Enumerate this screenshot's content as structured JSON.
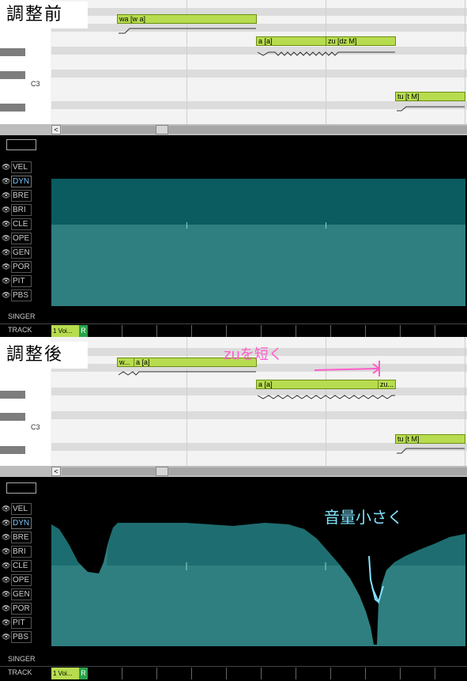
{
  "before": {
    "title": "調整前",
    "octave_label": "C3",
    "notes": [
      {
        "id": "wa",
        "label": "wa [w a]"
      },
      {
        "id": "a",
        "label": "a [a]"
      },
      {
        "id": "zu",
        "label": "zu [dz M]"
      },
      {
        "id": "tu",
        "label": "tu [t M]"
      }
    ]
  },
  "after": {
    "title": "調整後",
    "octave_label": "C3",
    "notes": [
      {
        "id": "w",
        "label": "w..."
      },
      {
        "id": "a1",
        "label": "a [a]"
      },
      {
        "id": "a2",
        "label": "a [a]"
      },
      {
        "id": "zu",
        "label": "zu..."
      },
      {
        "id": "tu",
        "label": "tu [t M]"
      }
    ],
    "annotation_shorten": "zuを短く",
    "annotation_volume": "音量小さく"
  },
  "scroll_left_glyph": "<",
  "params": [
    "VEL",
    "DYN",
    "BRE",
    "BRI",
    "CLE",
    "OPE",
    "GEN",
    "POR",
    "PIT",
    "PBS"
  ],
  "active_param": "DYN",
  "bottom": {
    "singer_label": "SINGER",
    "track_label": "TRACK",
    "track_name": "1 Voi...",
    "track_r": "R"
  },
  "colors": {
    "note_fill": "#b7dc4f",
    "dyn_fill": "#2f7f80",
    "dyn_fill_upper": "#0a5c60",
    "annot_pink": "#ff5cc8",
    "annot_cyan": "#7fe3ff"
  }
}
